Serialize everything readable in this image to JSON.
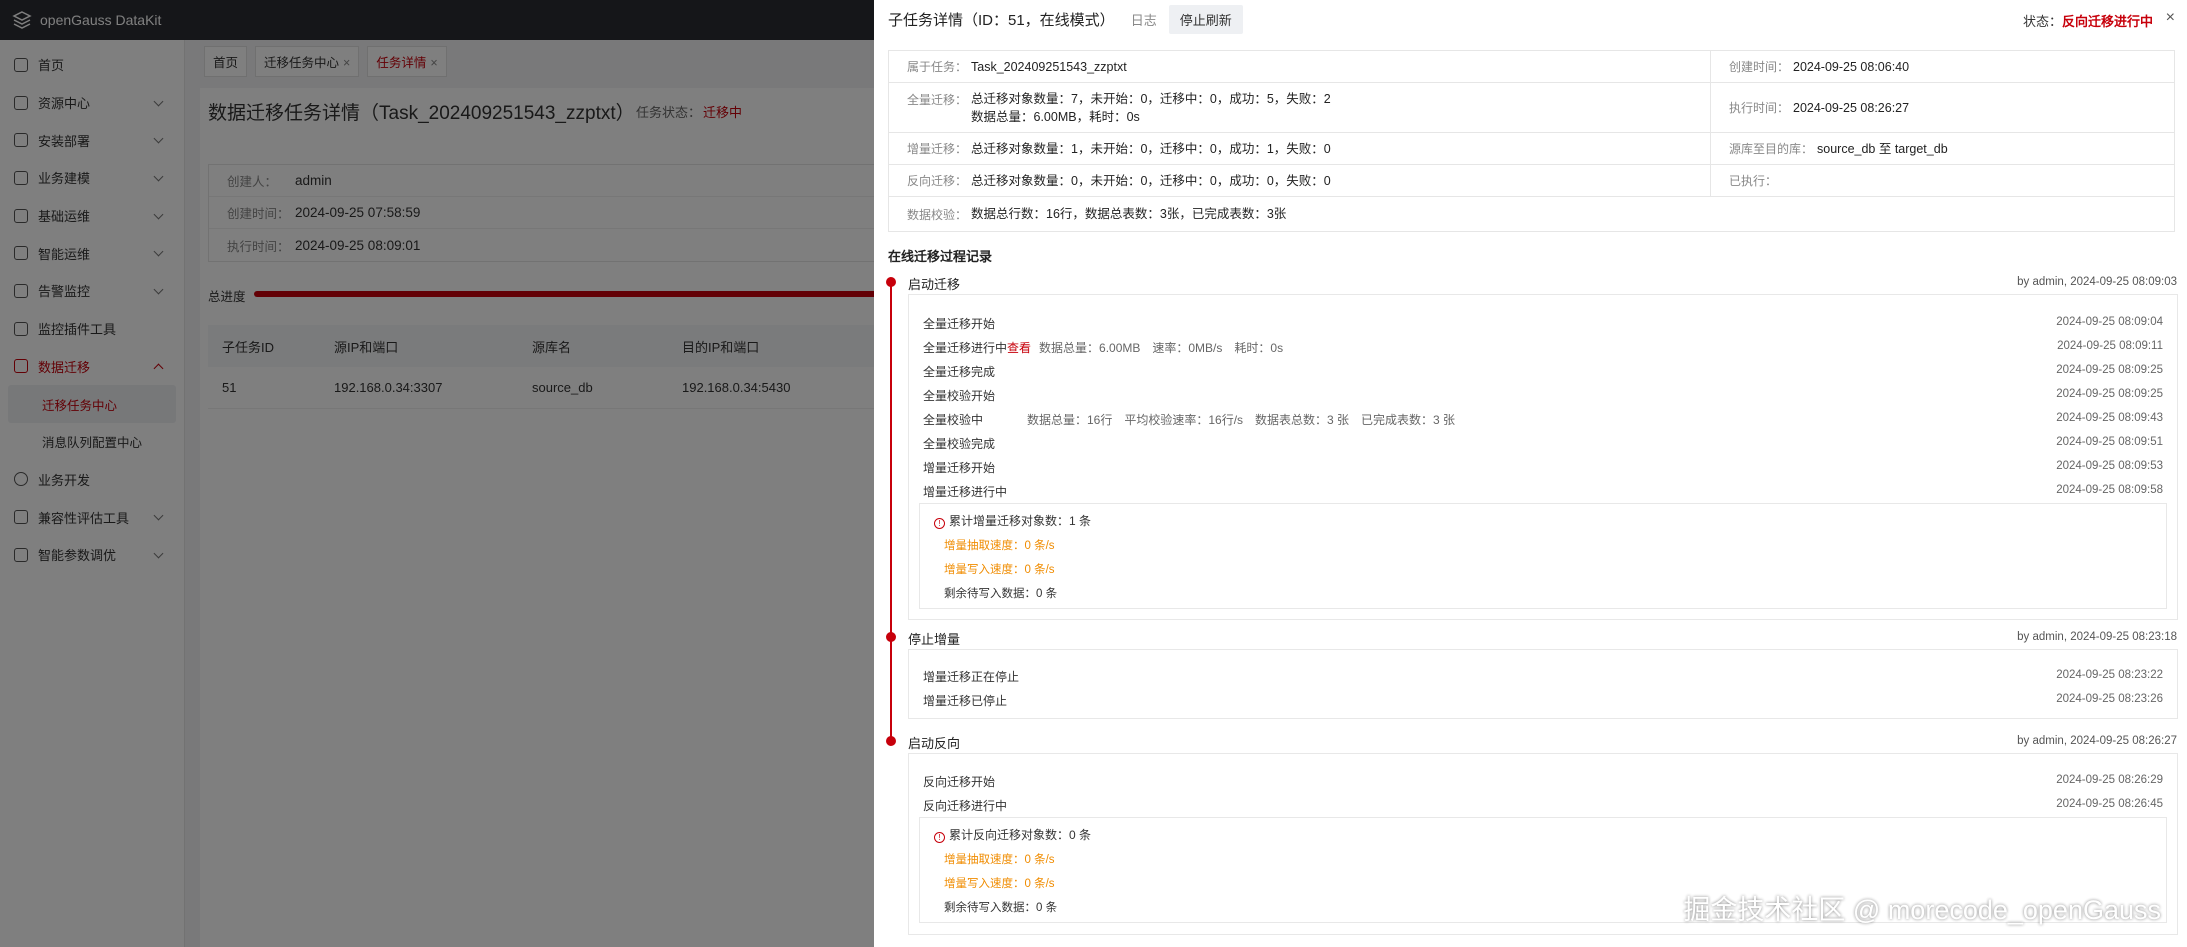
{
  "app": {
    "title": "openGauss DataKit"
  },
  "sidebar": {
    "items": [
      {
        "label": "首页",
        "has_children": false
      },
      {
        "label": "资源中心",
        "has_children": true
      },
      {
        "label": "安装部署",
        "has_children": true
      },
      {
        "label": "业务建模",
        "has_children": true
      },
      {
        "label": "基础运维",
        "has_children": true
      },
      {
        "label": "智能运维",
        "has_children": true
      },
      {
        "label": "告警监控",
        "has_children": true
      },
      {
        "label": "监控插件工具",
        "has_children": false
      },
      {
        "label": "数据迁移",
        "has_children": true,
        "open": true
      },
      {
        "label": "迁移任务中心",
        "sub": true,
        "active": true
      },
      {
        "label": "消息队列配置中心",
        "sub": true
      },
      {
        "label": "业务开发",
        "has_children": false
      },
      {
        "label": "兼容性评估工具",
        "has_children": true
      },
      {
        "label": "智能参数调优",
        "has_children": true
      }
    ]
  },
  "breadcrumb_tabs": [
    {
      "label": "首页"
    },
    {
      "label": "迁移任务中心",
      "closable": true
    },
    {
      "label": "任务详情",
      "closable": true,
      "active": true
    }
  ],
  "page": {
    "title": "数据迁移任务详情（Task_202409251543_zzptxt）",
    "status_label": "任务状态：",
    "status_value": "迁移中",
    "info": [
      {
        "k": "创建人：",
        "v": "admin"
      },
      {
        "k": "创建时间：",
        "v": "2024-09-25 07:58:59"
      },
      {
        "k": "执行时间：",
        "v": "2024-09-25 08:09:01"
      }
    ],
    "progress_label": "总进度",
    "table": {
      "headers": [
        "子任务ID",
        "源IP和端口",
        "源库名",
        "目的IP和端口"
      ],
      "rows": [
        [
          "51",
          "192.168.0.34:3307",
          "source_db",
          "192.168.0.34:5430"
        ]
      ]
    }
  },
  "drawer": {
    "title": "子任务详情（ID：51，在线模式）",
    "log_link": "日志",
    "stop_refresh": "停止刷新",
    "state_label": "状态：",
    "state_value": "反向迁移进行中",
    "close": "×",
    "grid": {
      "belong_k": "属于任务：",
      "belong_v": "Task_202409251543_zzptxt",
      "ctime_k": "创建时间：",
      "ctime_v": "2024-09-25 08:06:40",
      "full_k": "全量迁移：",
      "full_v1": "总迁移对象数量：7，未开始：0，迁移中：0，成功：5，失败：2",
      "full_v2": "数据总量：6.00MB，耗时：0s",
      "etime_k": "执行时间：",
      "etime_v": "2024-09-25 08:26:27",
      "inc_k": "增量迁移：",
      "inc_v": "总迁移对象数量：1，未开始：0，迁移中：0，成功：1，失败：0",
      "db_k": "源库至目的库：",
      "db_v": "source_db 至 target_db",
      "rev_k": "反向迁移：",
      "rev_v": "总迁移对象数量：0，未开始：0，迁移中：0，成功：0，失败：0",
      "exec_k": "已执行：",
      "check_k": "数据校验：",
      "check_v": "数据总行数：16行，数据总表数：3张，已完成表数：3张"
    },
    "section_title": "在线迁移过程记录",
    "stages": [
      {
        "title": "启动迁移",
        "by": "by admin, 2024-09-25 08:09:03",
        "events": [
          {
            "label": "全量迁移开始",
            "time": "2024-09-25 08:09:04"
          },
          {
            "label": "全量迁移进行中",
            "link": "查看",
            "extra": "数据总量：6.00MB　速率：0MB/s　耗时：0s",
            "time": "2024-09-25 08:09:11"
          },
          {
            "label": "全量迁移完成",
            "time": "2024-09-25 08:09:25"
          },
          {
            "label": "全量校验开始",
            "time": "2024-09-25 08:09:25"
          },
          {
            "label": "全量校验中",
            "extra": "数据总量：16行　平均校验速率：16行/s　数据表总数：3 张　已完成表数：3 张",
            "time": "2024-09-25 08:09:43"
          },
          {
            "label": "全量校验完成",
            "time": "2024-09-25 08:09:51"
          },
          {
            "label": "增量迁移开始",
            "time": "2024-09-25 08:09:53"
          },
          {
            "label": "增量迁移进行中",
            "time": "2024-09-25 08:09:58"
          }
        ],
        "box": {
          "head": "累计增量迁移对象数：1 条",
          "rate1": "增量抽取速度：0 条/s",
          "rate2": "增量写入速度：0 条/s",
          "remain": "剩余待写入数据：0 条"
        }
      },
      {
        "title": "停止增量",
        "by": "by admin, 2024-09-25 08:23:18",
        "events": [
          {
            "label": "增量迁移正在停止",
            "time": "2024-09-25 08:23:22"
          },
          {
            "label": "增量迁移已停止",
            "time": "2024-09-25 08:23:26"
          }
        ]
      },
      {
        "title": "启动反向",
        "by": "by admin, 2024-09-25 08:26:27",
        "events": [
          {
            "label": "反向迁移开始",
            "time": "2024-09-25 08:26:29"
          },
          {
            "label": "反向迁移进行中",
            "time": "2024-09-25 08:26:45"
          }
        ],
        "box": {
          "head": "累计反向迁移对象数：0 条",
          "rate1": "增量抽取速度：0 条/s",
          "rate2": "增量写入速度：0 条/s",
          "remain": "剩余待写入数据：0 条"
        }
      }
    ]
  },
  "watermark": "掘金技术社区 @ morecode_openGauss",
  "colors": {
    "accent": "#c7000b",
    "topbar": "#2b2d33",
    "warn": "#f08c00"
  }
}
